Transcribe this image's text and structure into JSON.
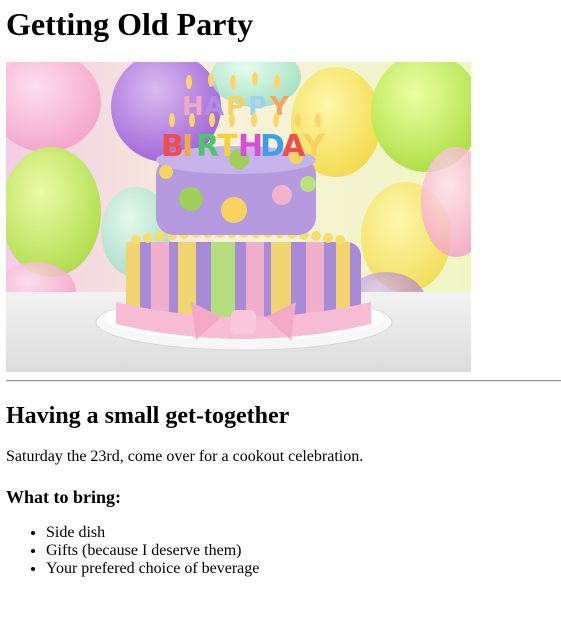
{
  "page": {
    "title": "Getting Old Party",
    "hero_image": {
      "subject": "birthday cake with candles",
      "candle_text": [
        "HAPPY",
        "BIRTHDAY"
      ]
    },
    "event_heading": "Having a small get-together",
    "event_description": "Saturday the 23rd, come over for a cookout celebration.",
    "bring_heading": "What to bring:",
    "bring_items": [
      "Side dish",
      "Gifts (because I deserve them)",
      "Your prefered choice of beverage"
    ]
  },
  "colors": {
    "divider": "#9a9a9a",
    "cake_purple": "#a98ad6",
    "ribbon_pink": "#f4b3cc"
  }
}
